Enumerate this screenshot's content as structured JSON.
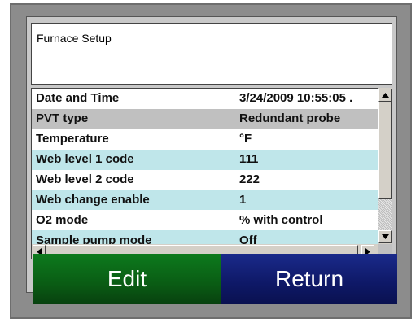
{
  "window": {
    "title": "Furnace Setup"
  },
  "settings": [
    {
      "label": "Date and Time",
      "value": "3/24/2009 10:55:05 .",
      "style": "white"
    },
    {
      "label": "PVT type",
      "value": "Redundant probe",
      "style": "grey"
    },
    {
      "label": "Temperature",
      "value": "°F",
      "style": "white"
    },
    {
      "label": "Web level 1 code",
      "value": "111",
      "style": "cyan"
    },
    {
      "label": "Web level 2 code",
      "value": "222",
      "style": "white"
    },
    {
      "label": "Web change enable",
      "value": "1",
      "style": "cyan"
    },
    {
      "label": "O2 mode",
      "value": "% with control",
      "style": "white"
    },
    {
      "label": "Sample pump mode",
      "value": "Off",
      "style": "cyan"
    }
  ],
  "buttons": {
    "edit": "Edit",
    "return": "Return"
  },
  "colors": {
    "edit_bg": "#0a5c14",
    "return_bg": "#0e1866",
    "row_highlight": "#bfe6ea",
    "row_selected": "#c0c0c0"
  },
  "icons": {
    "scroll_up": "up-arrow-icon",
    "scroll_down": "down-arrow-icon",
    "scroll_left": "left-arrow-icon",
    "scroll_right": "right-arrow-icon"
  }
}
